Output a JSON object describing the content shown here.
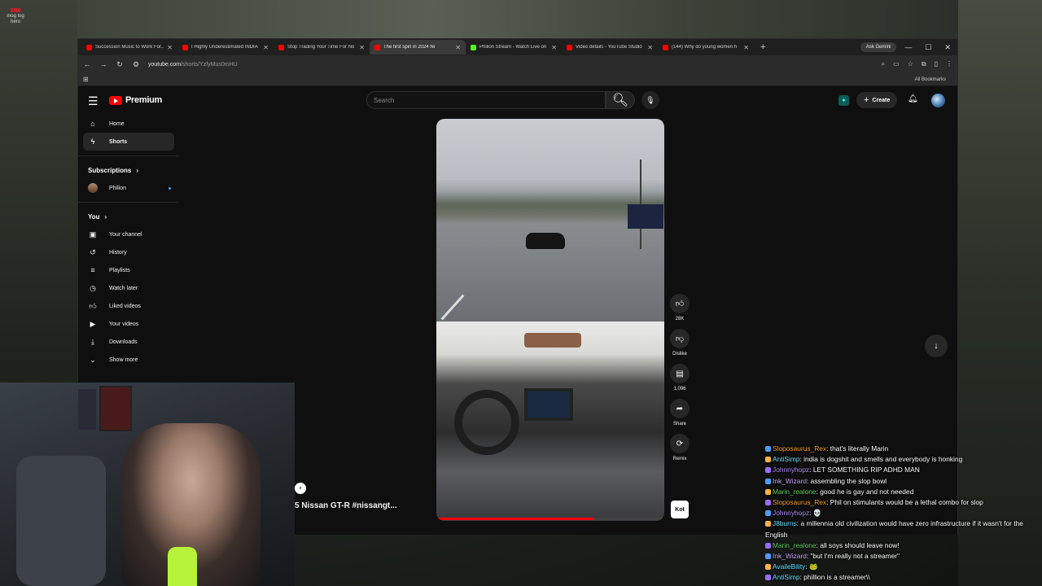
{
  "overlay_label": "mog log hero",
  "browser": {
    "tabs": [
      {
        "title": "Succession Music to Work For...",
        "active": false,
        "favicon": "youtube"
      },
      {
        "title": "I Highly Underestimated INDIA",
        "active": false,
        "favicon": "youtube"
      },
      {
        "title": "Stop Trading Your Time For No",
        "active": false,
        "favicon": "youtube"
      },
      {
        "title": "The first spin in 2024 Ni",
        "active": true,
        "favicon": "youtube"
      },
      {
        "title": "Philion Stream - Watch Live on",
        "active": false,
        "favicon": "kick"
      },
      {
        "title": "Video details - YouTube Studio",
        "active": false,
        "favicon": "youtube"
      },
      {
        "title": "(144) Why do young women h",
        "active": false,
        "favicon": "youtube"
      }
    ],
    "ask_gemini": "Ask Gemini",
    "url_host": "youtube.com",
    "url_path": "/shorts/YzfyMus0mHU",
    "all_bookmarks": "All Bookmarks"
  },
  "youtube": {
    "logo": "Premium",
    "search_placeholder": "Search",
    "create_label": "Create",
    "sidebar": {
      "home": "Home",
      "shorts": "Shorts",
      "subscriptions": "Subscriptions",
      "channel": "Philion",
      "you": "You",
      "your_channel": "Your channel",
      "history": "History",
      "playlists": "Playlists",
      "watch_later": "Watch later",
      "liked": "Liked videos",
      "your_videos": "Your videos",
      "downloads": "Downloads",
      "show_more": "Show more"
    },
    "actions": {
      "likes": "28K",
      "dislike": "Dislike",
      "comments": "1,096",
      "share": "Share",
      "remix": "Remix"
    },
    "sound_thumb": "Kot",
    "short_title": "5 Nissan GT-R #nissangt...",
    "progress": 0.69
  },
  "chat": [
    {
      "user": "Sloposaurus_Rex",
      "text": "that's literally Marin",
      "color": "u1"
    },
    {
      "user": "AntiSimp",
      "text": "india is dogshit and smells and everybody is honking",
      "color": "u2"
    },
    {
      "user": "Johnnyhopz",
      "text": "LET SOMETHING RIP ADHD MAN",
      "color": "u3"
    },
    {
      "user": "Ink_Wizard",
      "text": "assembling the slop bowl",
      "color": "u5"
    },
    {
      "user": "Marin_realone",
      "text": "good he is gay and not needed",
      "color": "u4"
    },
    {
      "user": "Sloposaurus_Rex",
      "text": "Phil on stimulants would be a lethal combo for slop",
      "color": "u1"
    },
    {
      "user": "Johnnyhopz",
      "text": "💀",
      "color": "u3"
    },
    {
      "user": "J8burns",
      "text": "a millennia old civilization would have zero infrastructure if it wasn't for the English",
      "color": "u2"
    },
    {
      "user": "Marin_realone",
      "text": "all soys should leave now!",
      "color": "u4"
    },
    {
      "user": "Ink_Wizard",
      "text": "\"but I'm really not a streamer\"",
      "color": "u5"
    },
    {
      "user": "AvaileBility",
      "text": "🐸",
      "color": "u2"
    },
    {
      "user": "AntiSimp",
      "text": "phillion is a streamer\\\\",
      "color": "u2"
    }
  ]
}
